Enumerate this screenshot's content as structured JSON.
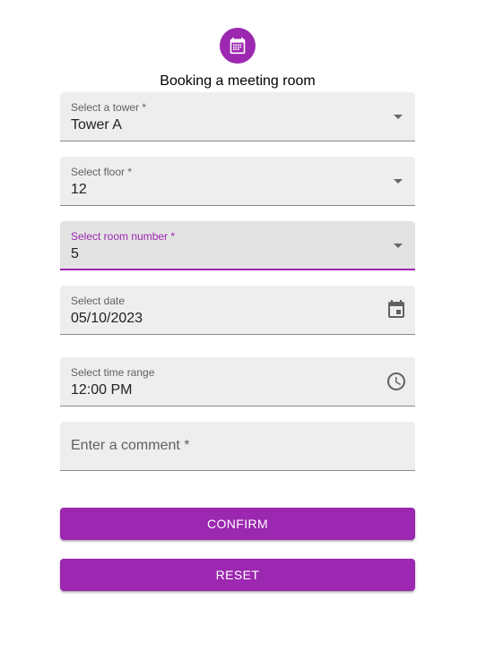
{
  "header": {
    "icon": "calendar-icon",
    "title": "Booking a meeting room"
  },
  "form": {
    "tower": {
      "label": "Select a tower *",
      "value": "Tower A"
    },
    "floor": {
      "label": "Select floor *",
      "value": "12"
    },
    "room": {
      "label": "Select room number *",
      "value": "5"
    },
    "date": {
      "label": "Select date",
      "value": "05/10/2023",
      "icon": "calendar-icon"
    },
    "time": {
      "label": "Select time range",
      "value": "12:00 PM",
      "icon": "clock-icon"
    },
    "comment": {
      "placeholder": "Enter a comment *",
      "value": ""
    }
  },
  "actions": {
    "confirm_label": "CONFIRM",
    "reset_label": "RESET"
  },
  "colors": {
    "primary": "#9c27b0",
    "field_bg": "#eeeeee",
    "field_bg_focused": "#e3e3e3"
  }
}
